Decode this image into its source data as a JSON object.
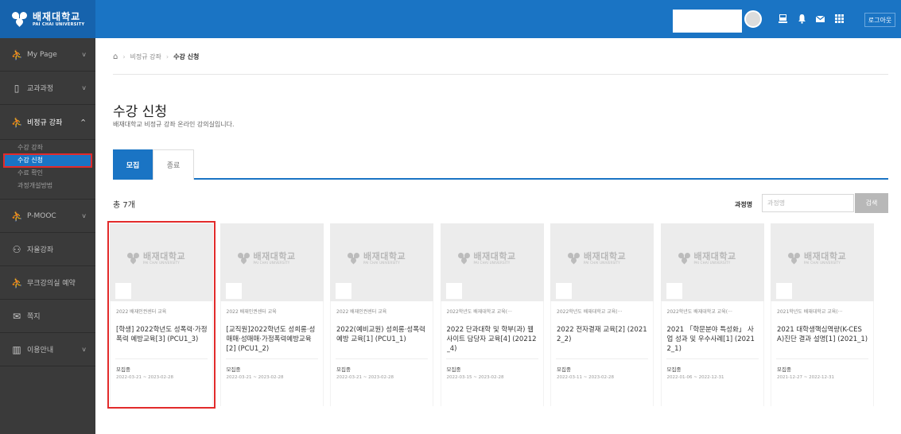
{
  "header": {
    "logo_ko": "배재대학교",
    "logo_en": "PAI CHAI UNIVERSITY",
    "logout_label": "로그아웃"
  },
  "sidebar": {
    "items": [
      {
        "label": "My Page",
        "icon": "person-icon",
        "chevron": "v"
      },
      {
        "label": "교과과정",
        "icon": "book-icon",
        "chevron": "v"
      },
      {
        "label": "비정규 강좌",
        "icon": "person-icon",
        "chevron": "^"
      },
      {
        "label": "P-MOOC",
        "icon": "person-icon",
        "chevron": "v"
      },
      {
        "label": "자율강좌",
        "icon": "people-icon",
        "chevron": ""
      },
      {
        "label": "무크강의실 예약",
        "icon": "person-icon",
        "chevron": ""
      },
      {
        "label": "쪽지",
        "icon": "mail-icon",
        "chevron": ""
      },
      {
        "label": "이용안내",
        "icon": "guide-icon",
        "chevron": "v"
      }
    ],
    "subitems": [
      "수강 강좌",
      "수강 신청",
      "수료 확인",
      "과정개설방법"
    ]
  },
  "breadcrumb": {
    "home_icon": "home-icon",
    "level1": "비정규 강좌",
    "level2": "수강 신청"
  },
  "page": {
    "title": "수강 신청",
    "subtitle": "배재대학교 비정규 강좌 온라인 강의실입니다."
  },
  "tabs": [
    "모집",
    "종료"
  ],
  "toolbar": {
    "count": "총 7개",
    "search_label": "과정명",
    "search_placeholder": "과정명",
    "search_button": "검색"
  },
  "thumb_logo": {
    "ko": "배재대학교",
    "en": "PAI CHAI UNIVERSITY"
  },
  "courses": [
    {
      "category": "2022 배재인권센터 교육",
      "title": "[학생] 2022학년도 성폭력·가정폭력 예방교육[3] (PCU1_3)",
      "status": "모집중",
      "period": "2022-03-21 ~ 2023-02-28"
    },
    {
      "category": "2022 배재인권센터 교육",
      "title": "[교직원]2022학년도 성희롱·성매매·성매매·가정폭력예방교육[2] (PCU1_2)",
      "status": "모집중",
      "period": "2022-03-21 ~ 2023-02-28"
    },
    {
      "category": "2022 배재인권센터 교육",
      "title": "2022(예비교원) 성희롱·성폭력예방 교육[1] (PCU1_1)",
      "status": "모집중",
      "period": "2022-03-21 ~ 2023-02-28"
    },
    {
      "category": "2022학년도 배재대학교 교육(···",
      "title": "2022 단과대학 및 학부(과) 웹사이트 담당자 교육[4] (20212_4)",
      "status": "모집중",
      "period": "2022-03-15 ~ 2023-02-28"
    },
    {
      "category": "2022학년도 배재대학교 교육(···",
      "title": "2022 전자결재 교육[2] (20212_2)",
      "status": "모집중",
      "period": "2022-03-11 ~ 2023-02-28"
    },
    {
      "category": "2022학년도 배재대학교 교육(···",
      "title": "2021 「학문분야 특성화」 사업 성과 및 우수사례[1] (20212_1)",
      "status": "모집중",
      "period": "2022-01-06 ~ 2022-12-31"
    },
    {
      "category": "2021학년도 배재대학교 교육(···",
      "title": "2021 대학생핵심역량(K-CESA)진단 결과 설명[1] (2021_1)",
      "status": "모집중",
      "period": "2021-12-27 ~ 2022-12-31"
    }
  ]
}
